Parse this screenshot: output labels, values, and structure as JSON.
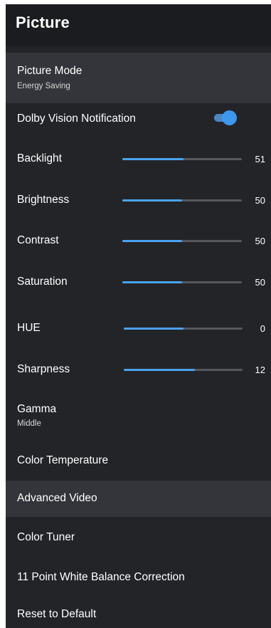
{
  "header": {
    "title": "Picture"
  },
  "picture_mode": {
    "label": "Picture Mode",
    "value": "Energy Saving"
  },
  "dolby": {
    "label": "Dolby Vision Notification",
    "enabled": true
  },
  "sliders": [
    {
      "label": "Backlight",
      "value": "51",
      "level": 0.51
    },
    {
      "label": "Brightness",
      "value": "50",
      "level": 0.5
    },
    {
      "label": "Contrast",
      "value": "50",
      "level": 0.5
    },
    {
      "label": "Saturation",
      "value": "50",
      "level": 0.5
    },
    {
      "label": "HUE",
      "value": "0",
      "level": 0.5
    },
    {
      "label": "Sharpness",
      "value": "12",
      "level": 0.6
    }
  ],
  "gamma": {
    "label": "Gamma",
    "value": "Middle"
  },
  "items": [
    {
      "label": "Color Temperature"
    },
    {
      "label": "Advanced Video"
    },
    {
      "label": "Color Tuner"
    },
    {
      "label": "11 Point White Balance Correction"
    },
    {
      "label": "Reset to Default"
    }
  ],
  "colors": {
    "panel": "#232428",
    "header": "#1b1c1f",
    "highlight": "#34353a",
    "accent": "#4aa3ee",
    "track": "#56585e"
  }
}
